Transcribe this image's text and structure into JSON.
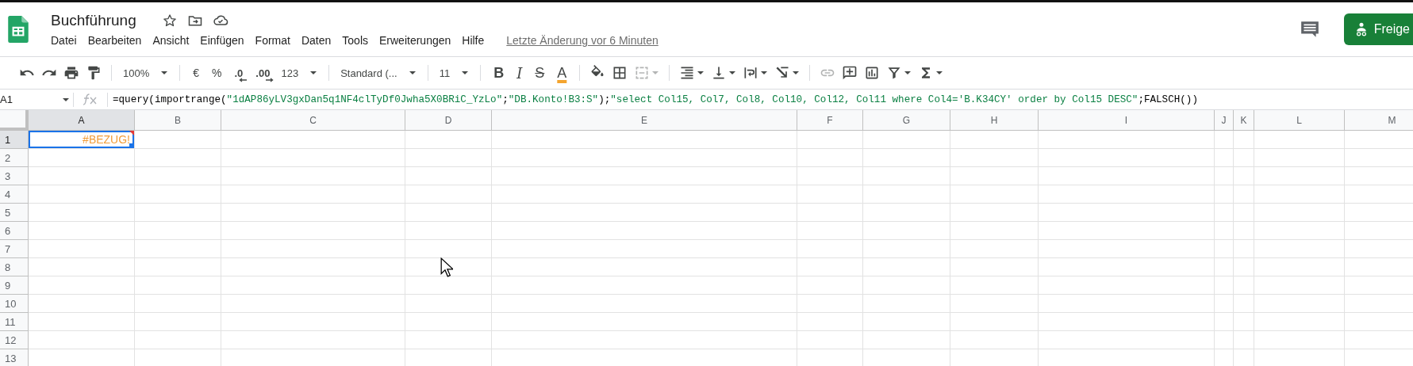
{
  "document": {
    "title": "Buchführung"
  },
  "menu": [
    {
      "label": "Datei"
    },
    {
      "label": "Bearbeiten"
    },
    {
      "label": "Ansicht"
    },
    {
      "label": "Einfügen"
    },
    {
      "label": "Format"
    },
    {
      "label": "Daten"
    },
    {
      "label": "Tools"
    },
    {
      "label": "Erweiterungen"
    },
    {
      "label": "Hilfe"
    }
  ],
  "last_edit": "Letzte Änderung vor 6 Minuten",
  "share_button": "Freige",
  "toolbar": [
    {
      "kind": "icon",
      "disabled": false
    },
    {
      "kind": "icon",
      "disabled": false
    },
    {
      "kind": "icon",
      "disabled": false
    },
    {
      "kind": "icon",
      "disabled": false
    },
    {
      "kind": "separator"
    },
    {
      "kind": "dropdown",
      "label": "100%"
    },
    {
      "kind": "separator"
    },
    {
      "kind": "text",
      "label": "€"
    },
    {
      "kind": "text",
      "label": "%"
    },
    {
      "kind": "decimal_decrease",
      "label": ".0"
    },
    {
      "kind": "decimal_increase",
      "label": ".00"
    },
    {
      "kind": "dropdown",
      "label": "123"
    },
    {
      "kind": "separator"
    },
    {
      "kind": "dropdown",
      "label": "Standard (..."
    },
    {
      "kind": "separator"
    },
    {
      "kind": "dropdown",
      "label": "11"
    },
    {
      "kind": "separator"
    },
    {
      "kind": "bold",
      "label": "B"
    },
    {
      "kind": "italic",
      "label": "I"
    },
    {
      "kind": "strike",
      "label": "S"
    },
    {
      "kind": "text_color",
      "label": "A"
    },
    {
      "kind": "separator"
    },
    {
      "kind": "icon",
      "disabled": false
    },
    {
      "kind": "icon",
      "disabled": false
    },
    {
      "kind": "icon",
      "disabled": true,
      "menu": true
    },
    {
      "kind": "separator"
    },
    {
      "kind": "icon",
      "disabled": false,
      "menu": true
    },
    {
      "kind": "icon",
      "disabled": false,
      "menu": true
    },
    {
      "kind": "icon",
      "disabled": false,
      "menu": true
    },
    {
      "kind": "icon",
      "disabled": false,
      "menu": true
    },
    {
      "kind": "separator"
    },
    {
      "kind": "icon",
      "disabled": true
    },
    {
      "kind": "icon",
      "disabled": false
    },
    {
      "kind": "icon",
      "disabled": false
    },
    {
      "kind": "icon",
      "disabled": false,
      "menu": true
    },
    {
      "kind": "icon",
      "disabled": false,
      "menu": true
    }
  ],
  "formula_bar": {
    "cell_ref": "A1",
    "formula": [
      {
        "kind": "code",
        "text": "=query(importrange("
      },
      {
        "kind": "string",
        "text": "\"1dAP86yLV3gxDan5q1NF4clTyDf0Jwha5X0BRiC_YzLo\""
      },
      {
        "kind": "code",
        "text": ";"
      },
      {
        "kind": "string",
        "text": "\"DB.Konto!B3:S\""
      },
      {
        "kind": "code",
        "text": ");"
      },
      {
        "kind": "string",
        "text": "\"select Col15, Col7, Col8, Col10, Col12, Col11 where Col4='B.K34CY' order by Col15 DESC\""
      },
      {
        "kind": "code",
        "text": ";FALSCH())"
      }
    ]
  },
  "grid": {
    "columns": [
      {
        "label": "A",
        "selected": true
      },
      {
        "label": "B",
        "selected": false
      },
      {
        "label": "C",
        "selected": false
      },
      {
        "label": "D",
        "selected": false
      },
      {
        "label": "E",
        "selected": false
      },
      {
        "label": "F",
        "selected": false
      },
      {
        "label": "G",
        "selected": false
      },
      {
        "label": "H",
        "selected": false
      },
      {
        "label": "I",
        "selected": false
      },
      {
        "label": "J",
        "selected": false
      },
      {
        "label": "K",
        "selected": false
      },
      {
        "label": "L",
        "selected": false
      },
      {
        "label": "M",
        "selected": false
      }
    ],
    "rows": [
      {
        "label": "1",
        "selected": true,
        "cells": [
          {
            "value": "#BEZUG!",
            "error": true,
            "selected": true
          }
        ]
      },
      {
        "label": "2",
        "selected": false
      },
      {
        "label": "3",
        "selected": false
      },
      {
        "label": "4",
        "selected": false
      },
      {
        "label": "5",
        "selected": false
      },
      {
        "label": "6",
        "selected": false
      },
      {
        "label": "7",
        "selected": false
      },
      {
        "label": "8",
        "selected": false
      },
      {
        "label": "9",
        "selected": false
      },
      {
        "label": "10",
        "selected": false
      },
      {
        "label": "11",
        "selected": false
      },
      {
        "label": "12",
        "selected": false
      },
      {
        "label": "13",
        "selected": false
      }
    ]
  }
}
